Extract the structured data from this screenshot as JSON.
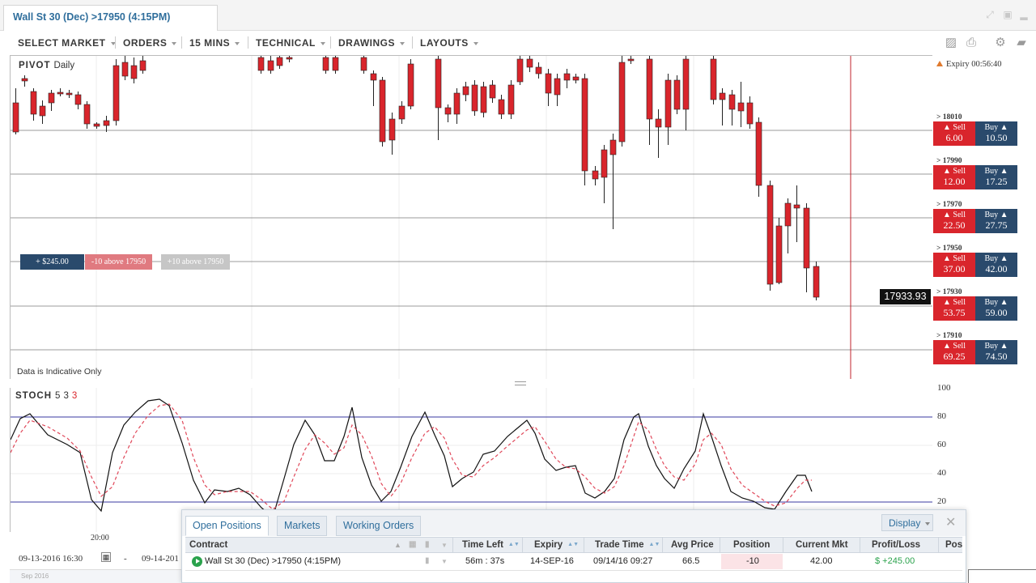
{
  "window": {
    "tab_title": "Wall St 30 (Dec) >17950 (4:15PM)"
  },
  "toolbar": {
    "menus": [
      "SELECT MARKET",
      "ORDERS",
      "15 MINS",
      "TECHNICAL",
      "DRAWINGS",
      "LAYOUTS"
    ],
    "icons": [
      "image-icon",
      "print-icon",
      "gear-icon",
      "chat-icon"
    ]
  },
  "chart": {
    "indicator_name": "PIVOT",
    "timeframe": "Daily",
    "disclaimer": "Data is Indicative Only",
    "current_price": "17933.93",
    "position_tags": [
      "+ $245.00",
      "-10 above 17950",
      "+10 above 17950"
    ],
    "colors": {
      "up": "#2ab02f",
      "down": "#d9252c",
      "expiry_line": "#c0232b"
    }
  },
  "ladder": {
    "expiry_label": "Expiry 00:56:40",
    "levels": [
      {
        "strike": "> 18010",
        "sell_label": "Sell",
        "sell": "6.00",
        "buy_label": "Buy",
        "buy": "10.50"
      },
      {
        "strike": "> 17990",
        "sell_label": "Sell",
        "sell": "12.00",
        "buy_label": "Buy",
        "buy": "17.25"
      },
      {
        "strike": "> 17970",
        "sell_label": "Sell",
        "sell": "22.50",
        "buy_label": "Buy",
        "buy": "27.75"
      },
      {
        "strike": "> 17950",
        "sell_label": "Sell",
        "sell": "37.00",
        "buy_label": "Buy",
        "buy": "42.00"
      },
      {
        "strike": "> 17930",
        "sell_label": "Sell",
        "sell": "53.75",
        "buy_label": "Buy",
        "buy": "59.00"
      },
      {
        "strike": "> 17910",
        "sell_label": "Sell",
        "sell": "69.25",
        "buy_label": "Buy",
        "buy": "74.50"
      }
    ]
  },
  "stoch": {
    "name": "STOCH",
    "p1": "5",
    "p2": "3",
    "p3": "3",
    "axis": [
      "100",
      "80",
      "60",
      "40",
      "20"
    ]
  },
  "time_axis": {
    "label": "20:00"
  },
  "date_bar": {
    "from": "09-13-2016 16:30",
    "dash": "-",
    "to": "09-14-201",
    "minimap_label": "Sep 2016"
  },
  "panel": {
    "tabs": [
      "Open Positions",
      "Markets",
      "Working Orders"
    ],
    "display_label": "Display",
    "close_symbol": "✕",
    "columns": [
      "Contract",
      "Time Left",
      "Expiry",
      "Trade Time",
      "Avg Price",
      "Position",
      "Current Mkt",
      "Profit/Loss",
      "Pos"
    ],
    "row": {
      "contract": "Wall St 30 (Dec) >17950 (4:15PM)",
      "time_left": "56m : 37s",
      "expiry": "14-SEP-16",
      "trade_time": "09/14/16 09:27",
      "avg_price": "66.5",
      "position": "-10",
      "current_mkt": "42.00",
      "profit_loss": "$ +245.00"
    }
  }
}
